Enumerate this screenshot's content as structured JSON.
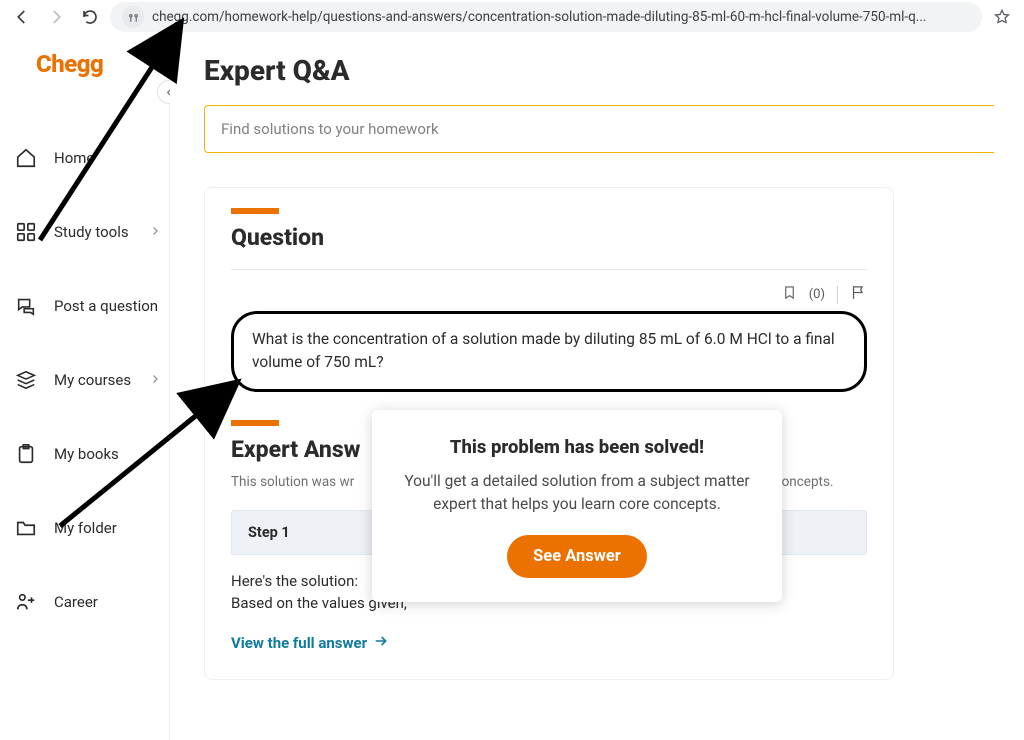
{
  "browser": {
    "url": "chegg.com/homework-help/questions-and-answers/concentration-solution-made-diluting-85-ml-60-m-hcl-final-volume-750-ml-q..."
  },
  "brand": "Chegg",
  "nav": {
    "home": "Home",
    "study_tools": "Study tools",
    "post_q": "Post a question",
    "courses": "My courses",
    "books": "My books",
    "folder": "My folder",
    "career": "Career"
  },
  "page": {
    "title": "Expert Q&A",
    "search_placeholder": "Find solutions to your homework"
  },
  "question": {
    "heading": "Question",
    "bookmark_count": "(0)",
    "text": "What is the concentration of a solution made by diluting 85 mL of 6.0 M HCl to a final volume of 750 mL?"
  },
  "answer": {
    "heading": "Expert Answ",
    "subtitle_pre": "This solution was wr",
    "subtitle_post": "a learn core concepts.",
    "step_label": "Step 1",
    "line1": "Here's the solution:",
    "line2": "Based on the values given,",
    "view_full": "View the full answer"
  },
  "popup": {
    "title": "This problem has been solved!",
    "body": "You'll get a detailed solution from a subject matter expert that helps you learn core concepts.",
    "cta": "See Answer"
  }
}
